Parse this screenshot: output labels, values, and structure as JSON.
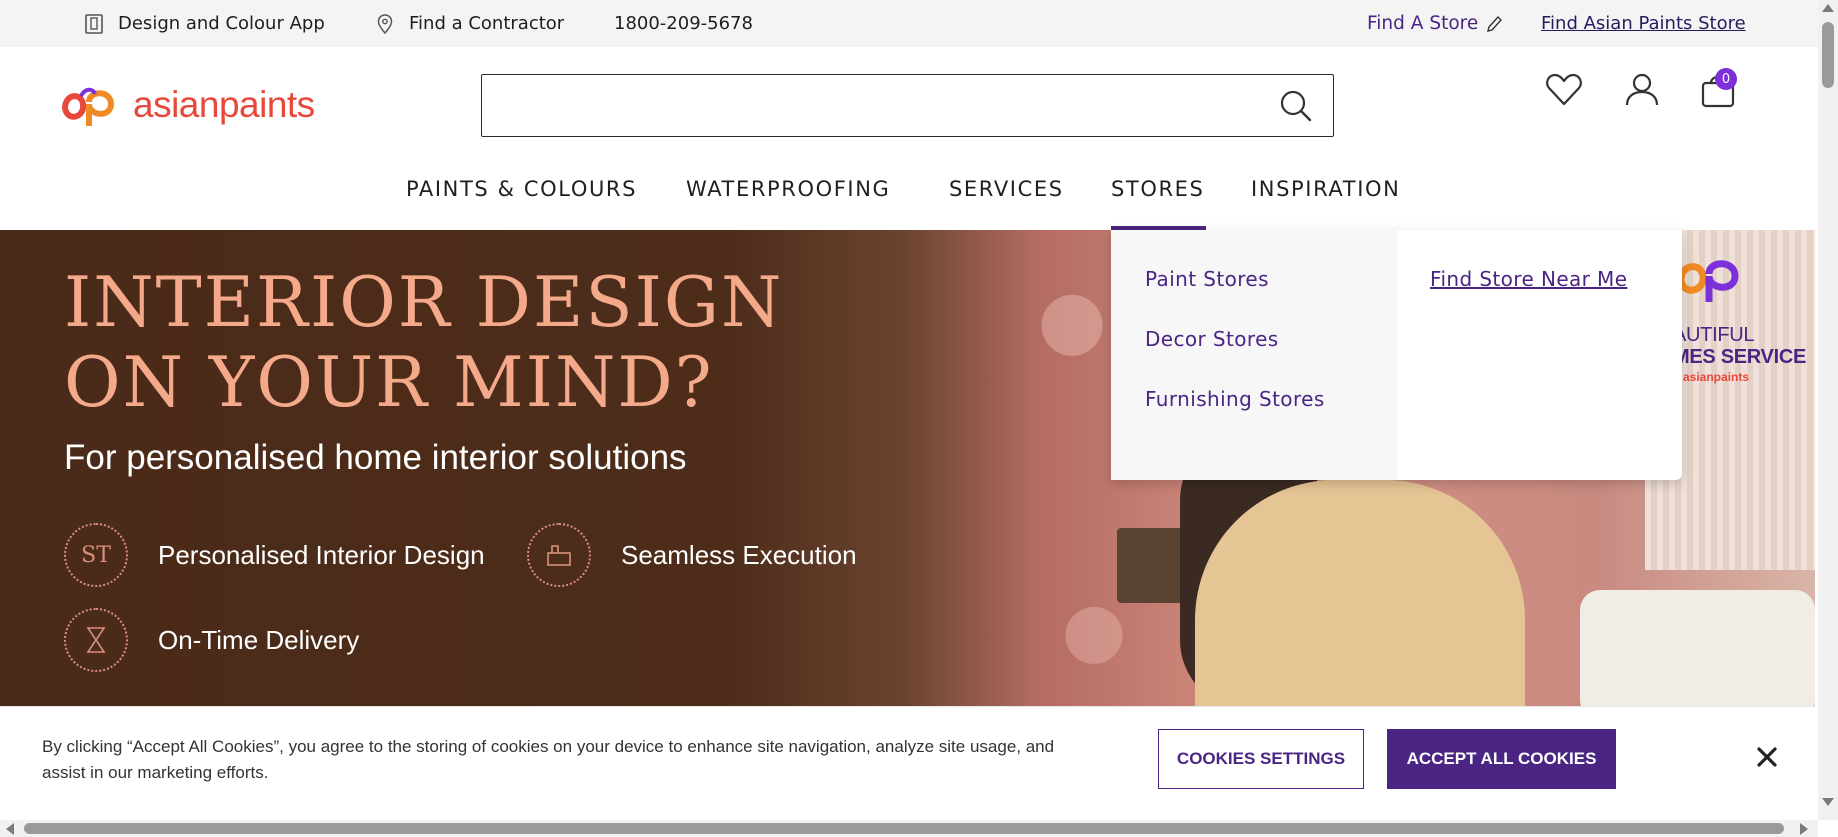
{
  "topbar": {
    "design_app": "Design and Colour App",
    "find_contractor": "Find a Contractor",
    "phone": "1800-209-5678",
    "find_store": "Find A Store",
    "find_asian_paints_store": "Find Asian Paints Store"
  },
  "header": {
    "logo_text": "asianpaints",
    "search_placeholder": "",
    "cart_count": "0"
  },
  "nav": {
    "items": [
      "PAINTS & COLOURS",
      "WATERPROOFING",
      "SERVICES",
      "STORES",
      "INSPIRATION"
    ],
    "active": "STORES"
  },
  "hero": {
    "title_line1": "INTERIOR DESIGN",
    "title_line2": "ON YOUR MIND?",
    "subtitle": "For personalised home interior solutions",
    "features": [
      {
        "label": "Personalised Interior Design",
        "icon": "monogram-st-icon"
      },
      {
        "label": "Seamless Execution",
        "icon": "execution-icon"
      },
      {
        "label": "On-Time Delivery",
        "icon": "hourglass-icon"
      }
    ],
    "badge_line1": "AUTIFUL",
    "badge_line2": "MES SERVICE",
    "badge_line3": "asianpaints"
  },
  "dropdown": {
    "left_items": [
      "Paint Stores",
      "Decor Stores",
      "Furnishing Stores"
    ],
    "right_link": "Find Store Near Me"
  },
  "cookie": {
    "text": "By clicking “Accept All Cookies”, you agree to the storing of cookies on your device to enhance site navigation, analyze site usage, and assist in our marketing efforts.",
    "settings_label": "COOKIES SETTINGS",
    "accept_label": "ACCEPT ALL COOKIES"
  },
  "colors": {
    "brand_purple": "#4b2583",
    "brand_red": "#e8483a",
    "hero_title": "#f4a98a"
  }
}
